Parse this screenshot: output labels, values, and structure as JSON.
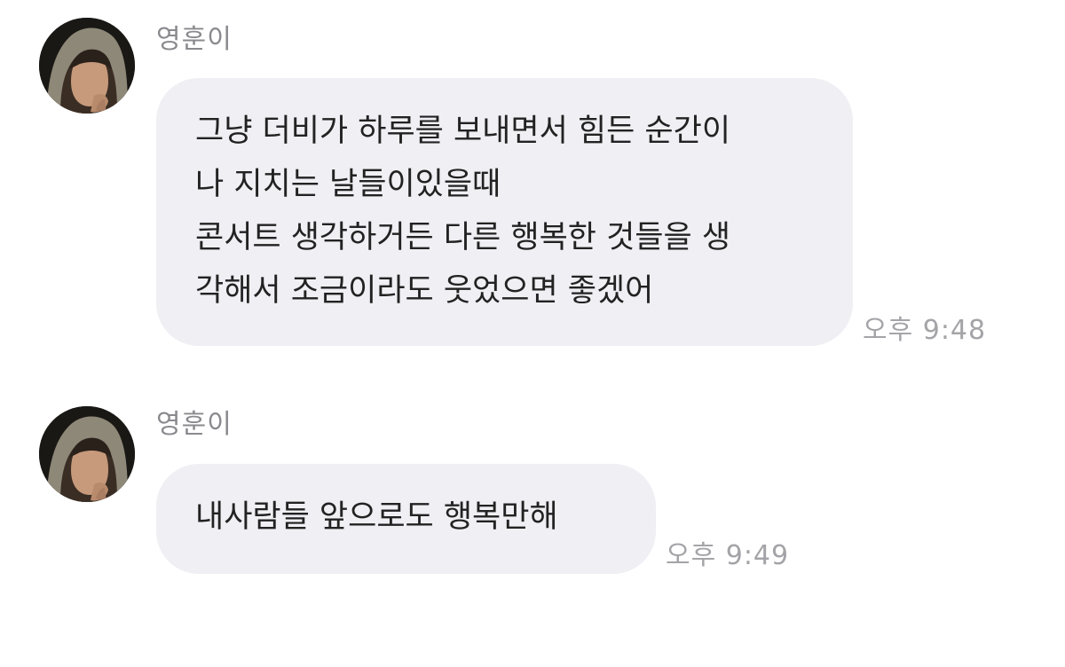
{
  "messages": [
    {
      "sender": "영훈이",
      "text": "그냥 더비가 하루를 보내면서 힘든 순간이\n나 지치는 날들이있을때\n콘서트 생각하거든 다른 행복한 것들을 생\n각해서 조금이라도 웃었으면 좋겠어",
      "time": "오후 9:48",
      "avatar_icon": "profile-photo"
    },
    {
      "sender": "영훈이",
      "text": "내사람들 앞으로도 행복만해",
      "time": "오후 9:49",
      "avatar_icon": "profile-photo"
    }
  ],
  "colors": {
    "background": "#ffffff",
    "bubble": "#efeff4",
    "message_text": "#222222",
    "sender_text": "#8a8a8e",
    "timestamp_text": "#a4a4a8"
  }
}
